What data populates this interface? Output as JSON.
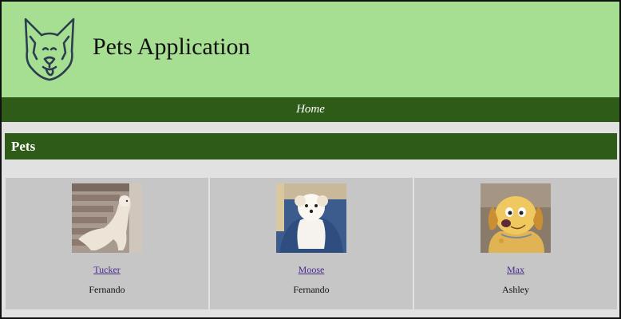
{
  "header": {
    "app_title": "Pets Application",
    "logo_icon": "dog-head-icon",
    "background_color": "#a6df92"
  },
  "nav": {
    "home_label": "Home",
    "background_color": "#2e5c18"
  },
  "section": {
    "title": "Pets"
  },
  "pets": [
    {
      "name": "Tucker",
      "owner": "Fernando",
      "photo_icon": "golden-retriever-on-stairs-photo"
    },
    {
      "name": "Moose",
      "owner": "Fernando",
      "photo_icon": "white-fluffy-dog-photo"
    },
    {
      "name": "Max",
      "owner": "Ashley",
      "photo_icon": "cartoon-golden-dog-photo"
    }
  ]
}
